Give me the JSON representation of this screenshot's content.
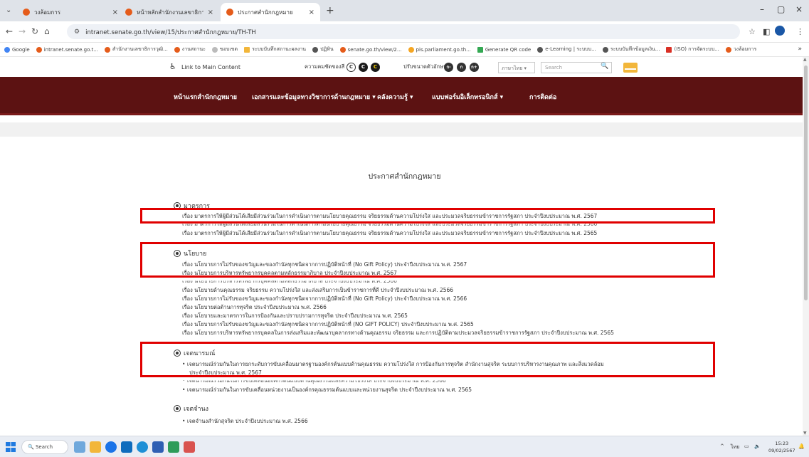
{
  "browser": {
    "tabs": [
      {
        "label": "วงล้อมการ"
      },
      {
        "label": "หน้าหลักสำนักงานเลขาธิการวุฒิสภา"
      },
      {
        "label": "ประกาศสำนักกฎหมาย"
      }
    ],
    "url": "intranet.senate.go.th/view/15/ประกาศสำนักกฎหมาย/TH-TH",
    "bookmarks": [
      "Google",
      "intranet.senate.go.t...",
      "สำนักงานเลขาธิการวุฒิ...",
      "งานสถานะ",
      "ขอบเขต",
      "ระบบบันทึกสถานะผลงาน",
      "ปฏิทิน",
      "senate.go.th/view/2...",
      "pis.parliament.go.th...",
      "Generate QR code",
      "e-Learning | ระบบบ...",
      "ระบบบันทึกข้อมูลเงิน...",
      "(ISO) การจัดระบบ...",
      "วงล้อมการ"
    ],
    "colors": {
      "accent": "#1a57a6",
      "tab_favicon": "#e55c1b"
    }
  },
  "site": {
    "util": {
      "main_link": "Link to Main Content",
      "contrast_label": "ความคมชัดของสี",
      "contrast_buttons": [
        "C",
        "C",
        "C"
      ],
      "font_size_label": "ปรับขนาดตัวอักษร",
      "font_size_buttons": [
        "ก-",
        "ก",
        "ก+"
      ],
      "lang_select": "ภาษาไทย",
      "search_placeholder": "Search"
    },
    "nav": [
      "หน้าแรกสำนักกฎหมาย",
      "เอกสารและข้อมูลทางวิชาการด้านกฎหมาย ▾",
      "คลังความรู้ ▾",
      "แบบฟอร์มอิเล็กทรอนิกส์ ▾",
      "การติดต่อ"
    ],
    "colors": {
      "nav_bg": "#5c1212",
      "highlight": "#e00000"
    }
  },
  "content": {
    "page_title": "ประกาศสำนักกฎหมาย",
    "sections": [
      {
        "title": "มาตรการ",
        "items": [
          "เรื่อง มาตรการให้ผู้มีส่วนได้เสียมีส่วนร่วมในการดำเนินการตามนโยบายคุณธรรม จริยธรรมด้านความโปร่งใส และประมวลจริยธรรมข้าราชการรัฐสภา ประจำปีงบประมาณ พ.ศ. 2567",
          "เรื่อง มาตรการให้ผู้มีส่วนได้เสียมีส่วนร่วมในการดำเนินการตามนโยบายคุณธรรม จริยธรรมด้านความโปร่งใส และประมวลจริยธรรมข้าราชการรัฐสภา ประจำปีงบประมาณ พ.ศ. 2566",
          "เรื่อง มาตรการให้ผู้มีส่วนได้เสียมีส่วนร่วมในการดำเนินการตามนโยบายคุณธรรม จริยธรรมด้านความโปร่งใส และประมวลจริยธรรมข้าราชการรัฐสภา ประจำปีงบประมาณ พ.ศ. 2565"
        ]
      },
      {
        "title": "นโยบาย",
        "items": [
          "เรื่อง นโยบายการไม่รับของขวัญและของกำนัลทุกชนิดจากการปฏิบัติหน้าที่ (No Gift Policy) ประจำปีงบประมาณ พ.ศ. 2567",
          "เรื่อง นโยบายการบริหารทรัพยากรบุคคลตามหลักธรรมาภิบาล ประจำปีงบประมาณ พ.ศ. 2567",
          "เรื่อง นโยบายการบริหารทรัพยากรบุคคลตามหลักธรรมาภิบาล ประจำปีงบประมาณ พ.ศ. 2566",
          "เรื่อง นโยบายด้านคุณธรรม จริยธรรม ความโปร่งใส และส่งเสริมการเป็นข้าราชการที่ดี ประจำปีงบประมาณ พ.ศ. 2566",
          "เรื่อง นโยบายการไม่รับของขวัญและของกำนัลทุกชนิดจากการปฏิบัติหน้าที่ (No Gift Policy) ประจำปีงบประมาณ พ.ศ. 2566",
          "เรื่อง นโยบายต่อต้านการทุจริต ประจำปีงบประมาณ พ.ศ. 2566",
          "เรื่อง นโยบายและมาตรการในการป้องกันและปราบปรามการทุจริต ประจำปีงบประมาณ พ.ศ. 2565",
          "เรื่อง นโยบายการไม่รับของขวัญและของกำนัลทุกชนิดจากการปฏิบัติหน้าที่ (NO GIFT POLICY) ประจำปีงบประมาณ พ.ศ. 2565",
          "เรื่อง นโยบายการบริหารทรัพยากรบุคคลในการส่งเสริมและพัฒนาบุคลากรทางด้านคุณธรรม จริยธรรม และการปฏิบัติตามประมวลจริยธรรมข้าราชการรัฐสภา ประจำปีงบประมาณ พ.ศ. 2565"
        ]
      },
      {
        "title": "เจตนารมณ์",
        "items": [
          "เจตนารมณ์ร่วมกันในการยกระดับการขับเคลื่อนมาตรฐานองค์กรต้นแบบด้านคุณธรรม ความโปร่งใส การป้องกันการทุจริต สำนักงานสุจริต ระบบการบริหารงานคุณภาพ และสิ่งแวดล้อม",
          "ประจำปีงบประมาณ พ.ศ. 2567",
          "เจตนารมณ์ร่วมกันในการขับเคลื่อนองค์กรต้นแบบด้านคุณธรรมและความโปร่งใส ประจำปีงบประมาณ พ.ศ. 2566",
          "เจตนารมณ์ร่วมกันในการขับเคลื่อนหน่วยงานเป็นองค์กรคุณธรรมต้นแบบและหน่วยงานสุจริต ประจำปีงบประมาณ พ.ศ. 2565"
        ]
      },
      {
        "title": "เจตจำนง",
        "items": [
          "เจตจำนงสำนักสุจริต ประจำปีงบประมาณ พ.ศ. 2566"
        ]
      }
    ]
  },
  "taskbar": {
    "search_label": "Search",
    "tray_lang": "ไทย",
    "time": "15:23",
    "date": "09/02/2567"
  }
}
